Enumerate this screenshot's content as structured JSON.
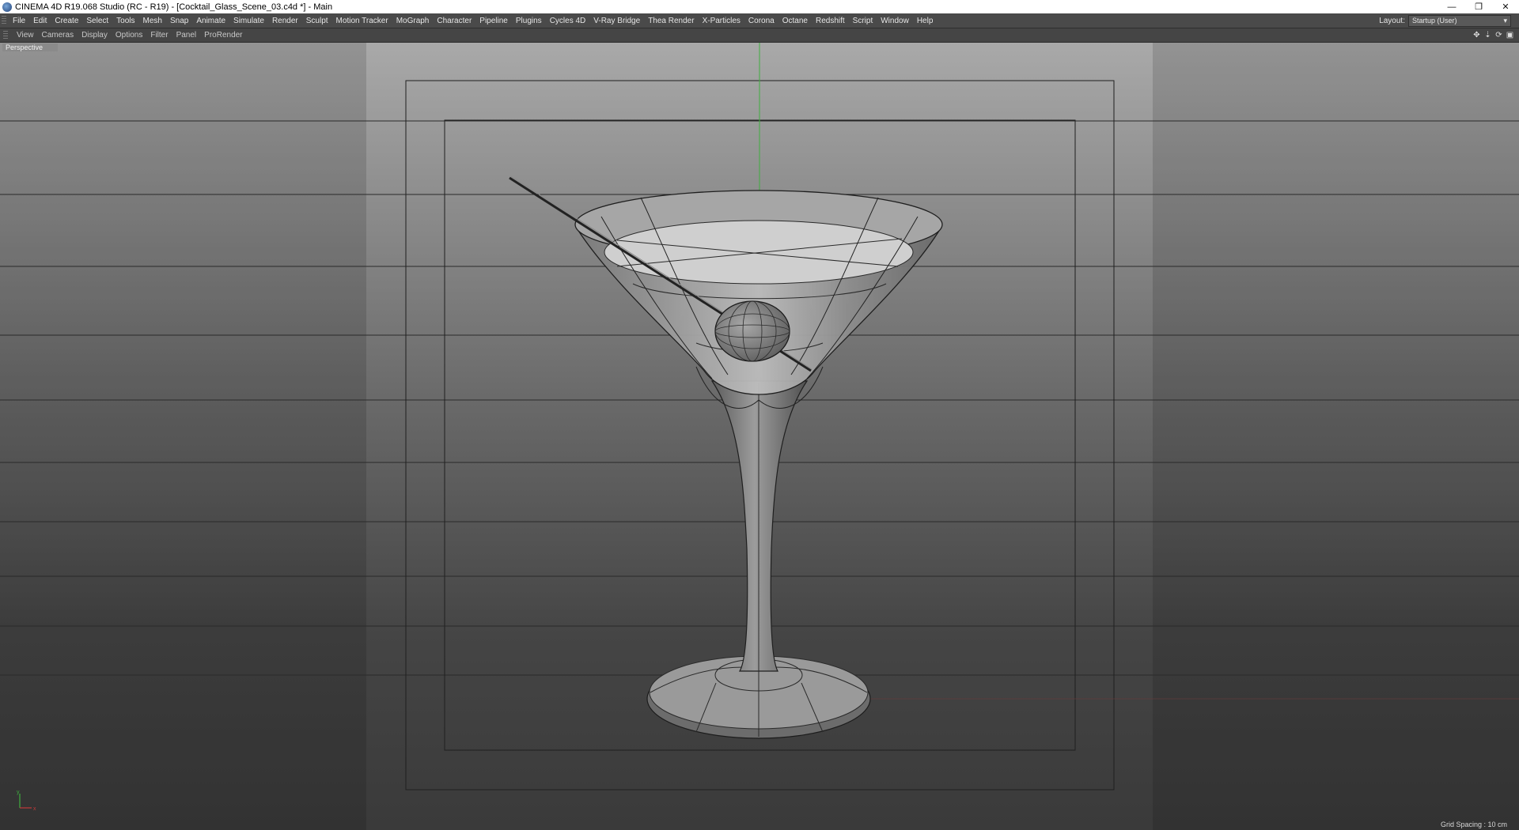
{
  "window": {
    "title": "CINEMA 4D R19.068 Studio (RC - R19) - [Cocktail_Glass_Scene_03.c4d *] - Main",
    "controls": [
      "—",
      "❐",
      "✕"
    ]
  },
  "menubar": {
    "items": [
      "File",
      "Edit",
      "Create",
      "Select",
      "Tools",
      "Mesh",
      "Snap",
      "Animate",
      "Simulate",
      "Render",
      "Sculpt",
      "Motion Tracker",
      "MoGraph",
      "Character",
      "Pipeline",
      "Plugins",
      "Cycles 4D",
      "V-Ray Bridge",
      "Thea Render",
      "X-Particles",
      "Corona",
      "Octane",
      "Redshift",
      "Script",
      "Window",
      "Help"
    ],
    "layout_label": "Layout:",
    "layout_value": "Startup (User)"
  },
  "viewbar": {
    "items": [
      "View",
      "Cameras",
      "Display",
      "Options",
      "Filter",
      "Panel",
      "ProRender"
    ]
  },
  "viewport": {
    "camera_label": "Perspective",
    "grid_spacing": "Grid Spacing : 10 cm",
    "axis_x": "x",
    "axis_y": "y"
  },
  "colors": {
    "y_axis": "#3fae3f",
    "x_axis": "#c03a3a"
  }
}
